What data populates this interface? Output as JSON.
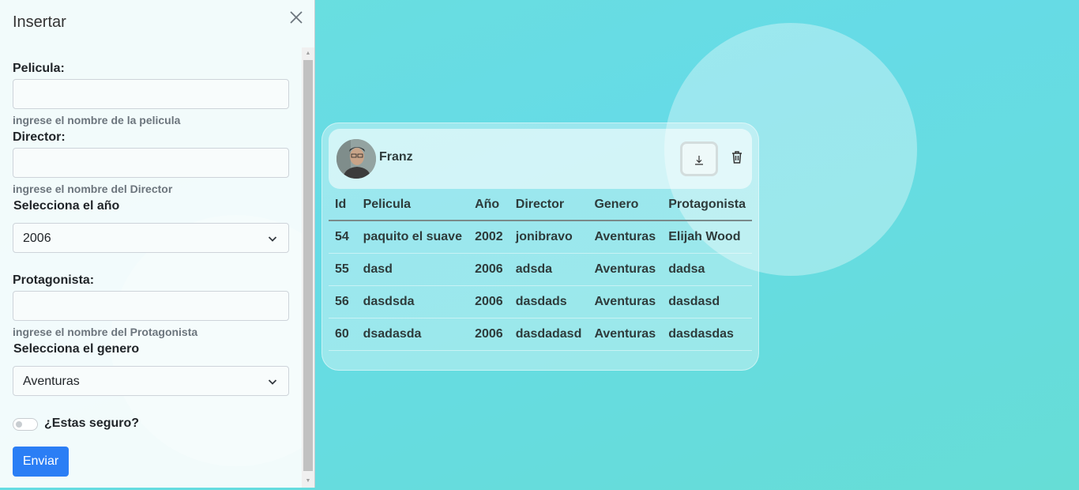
{
  "panel": {
    "title": "Insertar",
    "fields": {
      "pelicula": {
        "label": "Pelicula:",
        "value": "",
        "help": "ingrese el nombre de la pelicula"
      },
      "director": {
        "label": "Director:",
        "value": "",
        "help": "ingrese el nombre del Director"
      },
      "anio": {
        "label": "Selecciona el año",
        "selected": "2006"
      },
      "protagonista": {
        "label": "Protagonista:",
        "value": "",
        "help": "ingrese el nombre del Protagonista"
      },
      "genero": {
        "label": "Selecciona el genero",
        "selected": "Aventuras"
      }
    },
    "toggle_label": "¿Estas seguro?",
    "submit_label": "Enviar"
  },
  "card": {
    "user_name": "Franz",
    "columns": [
      "Id",
      "Pelicula",
      "Año",
      "Director",
      "Genero",
      "Protagonista"
    ],
    "rows": [
      [
        "54",
        "paquito el suave",
        "2002",
        "jonibravo",
        "Aventuras",
        "Elijah Wood"
      ],
      [
        "55",
        "dasd",
        "2006",
        "adsda",
        "Aventuras",
        "dadsa"
      ],
      [
        "56",
        "dasdsda",
        "2006",
        "dasdads",
        "Aventuras",
        "dasdasd"
      ],
      [
        "60",
        "dsadasda",
        "2006",
        "dasdadasd",
        "Aventuras",
        "dasdasdas"
      ]
    ],
    "icons": {
      "download": "arrow-down-to-line-icon",
      "delete": "trash-icon"
    }
  },
  "colors": {
    "primary": "#2b7ef5",
    "background": "#66dbe0"
  }
}
